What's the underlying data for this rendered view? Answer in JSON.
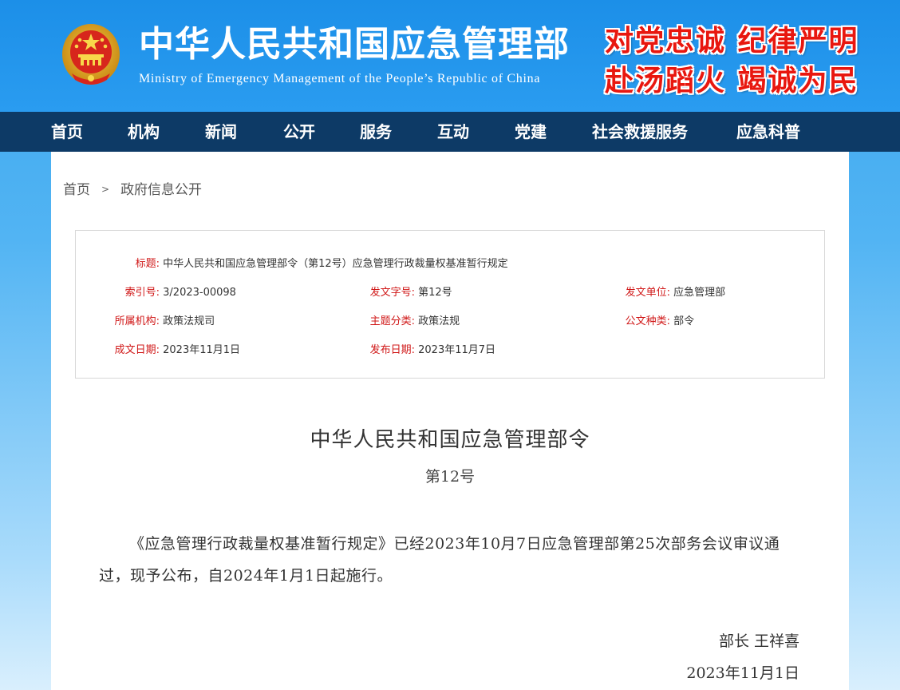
{
  "header": {
    "title": "中华人民共和国应急管理部",
    "subtitle": "Ministry of Emergency Management of the People’s Republic of China",
    "slogan_line1": "对党忠诚 纪律严明",
    "slogan_line2": "赴汤蹈火 竭诚为民",
    "emblem_icon": "national-emblem-icon"
  },
  "nav": {
    "items": [
      "首页",
      "机构",
      "新闻",
      "公开",
      "服务",
      "互动",
      "党建",
      "社会救援服务",
      "应急科普"
    ]
  },
  "breadcrumb": {
    "home": "首页",
    "separator": ">",
    "current": "政府信息公开"
  },
  "meta": {
    "title_label": "标题:",
    "title_value": "中华人民共和国应急管理部令（第12号）应急管理行政裁量权基准暂行规定",
    "index_label": "索引号:",
    "index_value": "3/2023-00098",
    "doc_no_label": "发文字号:",
    "doc_no_value": "第12号",
    "issuer_label": "发文单位:",
    "issuer_value": "应急管理部",
    "org_label": "所属机构:",
    "org_value": "政策法规司",
    "topic_label": "主题分类:",
    "topic_value": "政策法规",
    "type_label": "公文种类:",
    "type_value": "部令",
    "created_label": "成文日期:",
    "created_value": "2023年11月1日",
    "published_label": "发布日期:",
    "published_value": "2023年11月7日"
  },
  "document": {
    "title": "中华人民共和国应急管理部令",
    "number": "第12号",
    "body": "《应急管理行政裁量权基准暂行规定》已经2023年10月7日应急管理部第25次部务会议审议通过，现予公布，自2024年1月1日起施行。",
    "signature": "部长  王祥喜",
    "date": "2023年11月1日"
  },
  "colors": {
    "header_blue": "#1c8fe8",
    "nav_dark": "#0d3a66",
    "slogan_red": "#e8170f",
    "label_red": "#d01818"
  }
}
